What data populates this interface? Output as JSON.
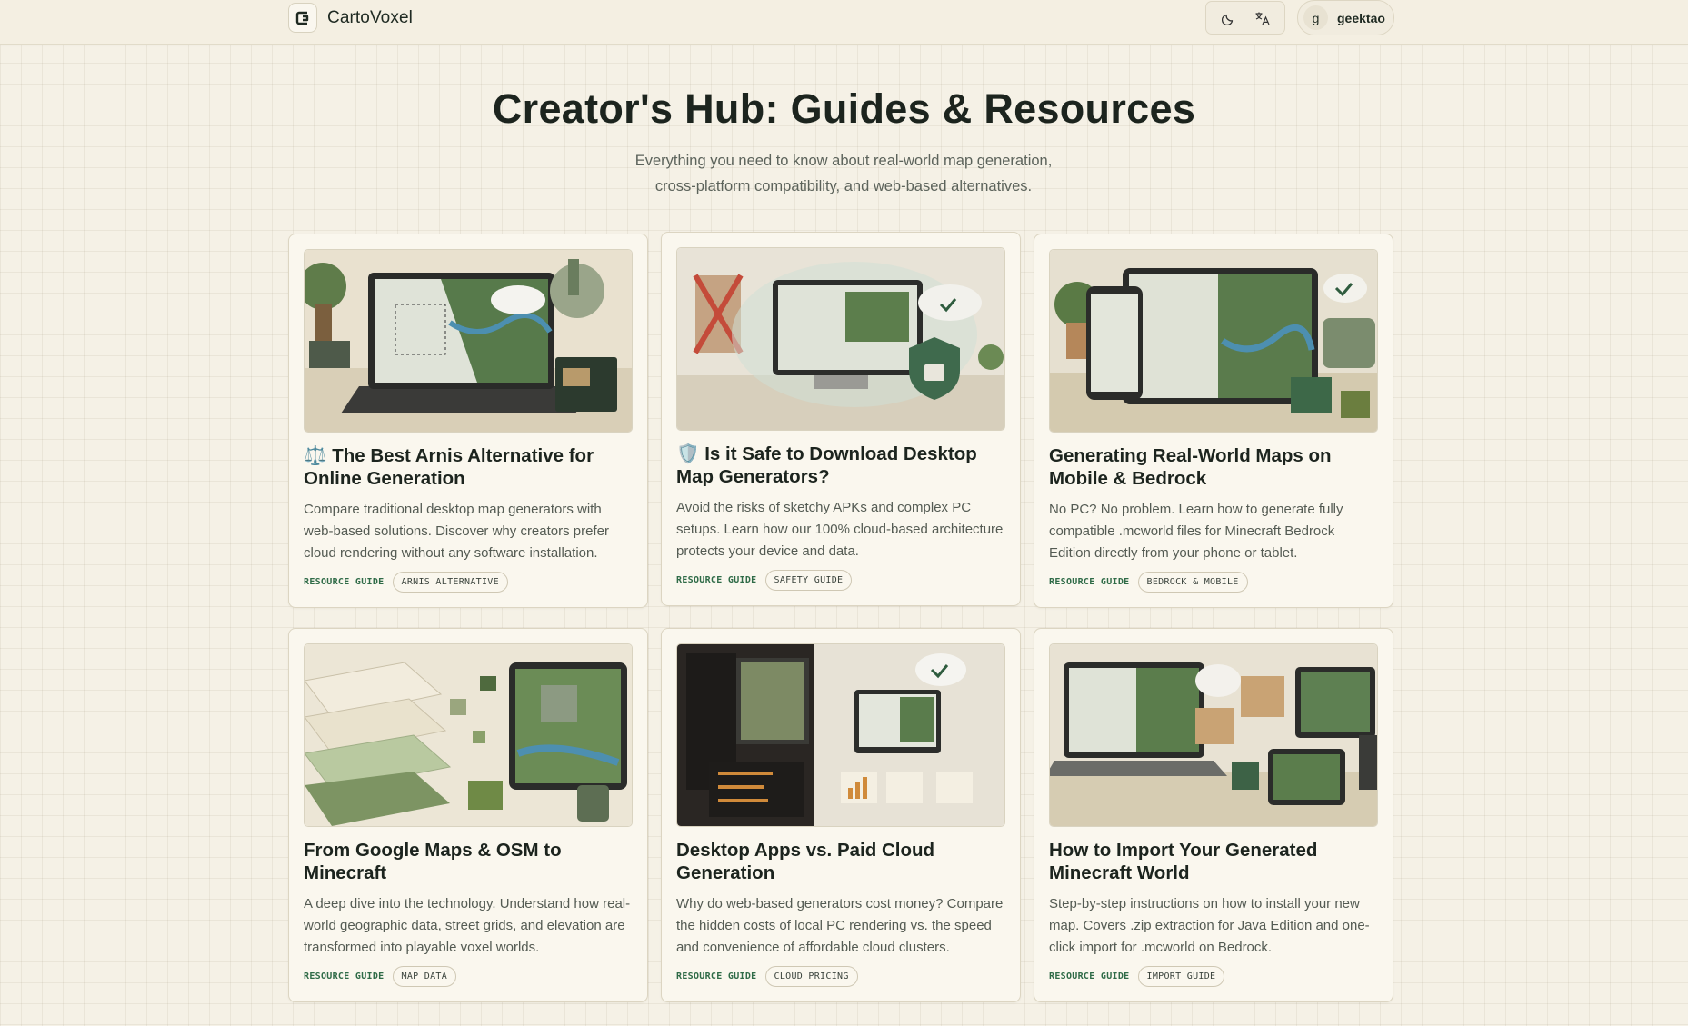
{
  "header": {
    "brand_name": "CartoVoxel",
    "theme_icon": "moon-icon",
    "language_icon": "translate-icon",
    "user": {
      "avatar_letter": "g",
      "username": "geektao"
    }
  },
  "hero": {
    "title": "Creator's Hub: Guides & Resources",
    "subtitle_line1": "Everything you need to know about real-world map generation,",
    "subtitle_line2": "cross-platform compatibility, and web-based alternatives."
  },
  "cards": [
    {
      "emoji": "⚖️",
      "title": "The Best Arnis Alternative for Online Generation",
      "description": "Compare traditional desktop map generators with web-based solutions. Discover why creators prefer cloud rendering without any software installation.",
      "kind": "RESOURCE GUIDE",
      "tag": "ARNIS ALTERNATIVE"
    },
    {
      "emoji": "🛡️",
      "title": "Is it Safe to Download Desktop Map Generators?",
      "description": "Avoid the risks of sketchy APKs and complex PC setups. Learn how our 100% cloud-based architecture protects your device and data.",
      "kind": "RESOURCE GUIDE",
      "tag": "SAFETY GUIDE"
    },
    {
      "emoji": "",
      "title": "Generating Real-World Maps on Mobile & Bedrock",
      "description": "No PC? No problem. Learn how to generate fully compatible .mcworld files for Minecraft Bedrock Edition directly from your phone or tablet.",
      "kind": "RESOURCE GUIDE",
      "tag": "BEDROCK & MOBILE"
    },
    {
      "emoji": "",
      "title": "From Google Maps & OSM to Minecraft",
      "description": "A deep dive into the technology. Understand how real-world geographic data, street grids, and elevation are transformed into playable voxel worlds.",
      "kind": "RESOURCE GUIDE",
      "tag": "MAP DATA"
    },
    {
      "emoji": "",
      "title": "Desktop Apps vs. Paid Cloud Generation",
      "description": "Why do web-based generators cost money? Compare the hidden costs of local PC rendering vs. the speed and convenience of affordable cloud clusters.",
      "kind": "RESOURCE GUIDE",
      "tag": "CLOUD PRICING"
    },
    {
      "emoji": "",
      "title": "How to Import Your Generated Minecraft World",
      "description": "Step-by-step instructions on how to install your new map. Covers .zip extraction for Java Edition and one-click import for .mcworld on Bedrock.",
      "kind": "RESOURCE GUIDE",
      "tag": "IMPORT GUIDE"
    }
  ]
}
